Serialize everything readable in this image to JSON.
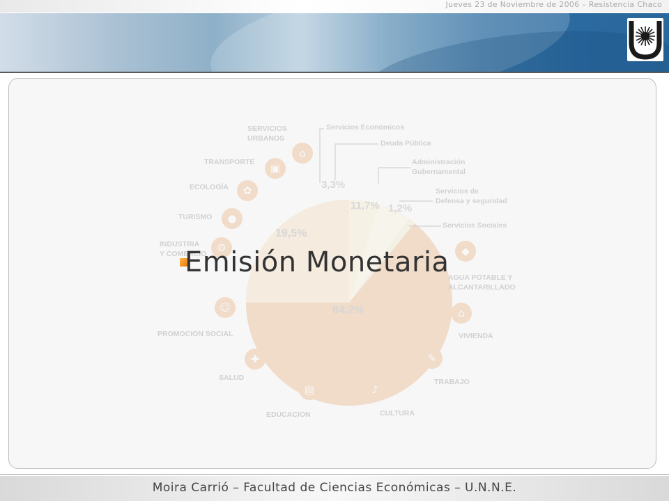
{
  "header": {
    "date_line": "Jueves 23 de Noviembre de 2006 – Resistencia Chaco",
    "logo": "unne-sun-logo"
  },
  "slide": {
    "title": "Emisión Monetaria"
  },
  "background_figure": {
    "percentages": [
      "3,3%",
      "11,7%",
      "1,2%",
      "19,5%",
      "64,2%"
    ],
    "legend": [
      "Servicios Económicos",
      "Deuda Pública",
      "Administración\nGubernamental",
      "Servicios de\nDefensa y seguridad",
      "Servicios Sociales"
    ],
    "sectors": [
      "SERVICIOS\nURBANOS",
      "TRANSPORTE",
      "ECOLOGÍA",
      "TURISMO",
      "INDUSTRIA\nY COMERCIO",
      "AGUA POTABLE Y\nALCANTARILLADO",
      "VIVIENDA",
      "PROMOCION SOCIAL",
      "TRABAJO",
      "SALUD",
      "EDUCACION",
      "CULTURA"
    ]
  },
  "footer": {
    "text": "Moira Carrió – Facultad de Ciencias Económicas – U.N.N.E."
  },
  "colors": {
    "banner_blue": "#2b6aa0",
    "bullet_orange": "#f0961e",
    "pie_orange": "#e07a2a",
    "pie_cream": "#f2e3a8"
  }
}
